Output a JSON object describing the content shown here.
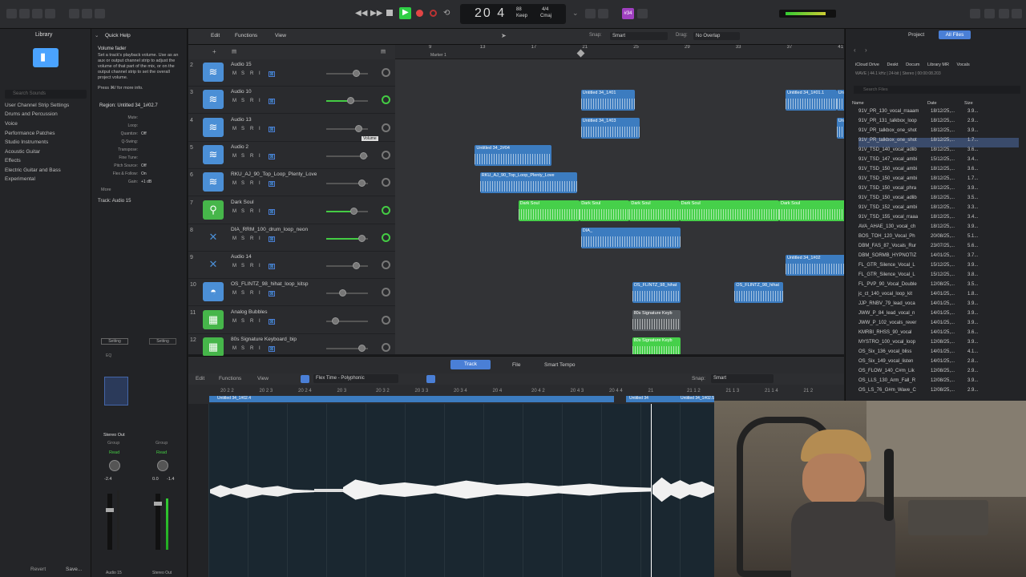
{
  "toolbar": {
    "lcd_position": "20 4",
    "lcd_tempo": "88",
    "lcd_tempo_label": "Keep",
    "lcd_sig": "4/4",
    "lcd_key": "Cmaj",
    "badge": "#34"
  },
  "library": {
    "title": "Library",
    "search_placeholder": "Search Sounds",
    "items": [
      "User Channel Strip Settings",
      "Drums and Percussion",
      "Voice",
      "Performance Patches",
      "Studio Instruments",
      "Acoustic Guitar",
      "Effects",
      "Electric Guitar and Bass",
      "Experimental"
    ],
    "revert": "Revert",
    "save": "Save..."
  },
  "inspector": {
    "title": "Quick Help",
    "help_title": "Volume fader",
    "help_text": "Set a track's playback volume. Use as an aux or output channel strip to adjust the volume of that part of the mix, or on the output channel strip to set the overall project volume.",
    "help_more": "Press ⌘/ for more info.",
    "region_label": "Region: Untitled 34_1#02.7",
    "fields": [
      {
        "k": "Mute:",
        "v": ""
      },
      {
        "k": "Loop:",
        "v": ""
      },
      {
        "k": "Quantize:",
        "v": "Off"
      },
      {
        "k": "Q-Swing:",
        "v": ""
      },
      {
        "k": "Transpose:",
        "v": ""
      },
      {
        "k": "Fine Tune:",
        "v": ""
      },
      {
        "k": "Pitch Source:",
        "v": "Off"
      },
      {
        "k": "Flex & Follow:",
        "v": "On"
      },
      {
        "k": "Gain:",
        "v": "+1 dB"
      }
    ],
    "more": "More",
    "track_label": "Track: Audio 15",
    "strip_left_name": "Audio 15",
    "strip_right_name": "Stereo Out",
    "strip_left_db": "-2.4",
    "strip_right_db": "0.0",
    "strip_right_db2": "-1.4",
    "read_left": "Read",
    "read_right": "Read",
    "stereo_out": "Stereo Out",
    "group": "Group",
    "setting": "Setting",
    "eq": "EQ"
  },
  "tracks_top": {
    "edit": "Edit",
    "functions": "Functions",
    "view": "View",
    "snap_label": "Snap:",
    "snap_value": "Smart",
    "drag_label": "Drag:",
    "drag_value": "No Overlap",
    "marker": "Marker 1",
    "bars": [
      "9",
      "13",
      "17",
      "21",
      "25",
      "29",
      "33",
      "37",
      "41"
    ]
  },
  "tracks": [
    {
      "num": "2",
      "name": "Audio 15",
      "color": "#4b8fd6",
      "kind": "audio",
      "vol": 0.72
    },
    {
      "num": "3",
      "name": "Audio 10",
      "color": "#4b8fd6",
      "kind": "audio",
      "vol": 0.58,
      "active": true
    },
    {
      "num": "4",
      "name": "Audio 13",
      "color": "#4b8fd6",
      "kind": "audio",
      "vol": 0.76,
      "tooltip": "Volume"
    },
    {
      "num": "5",
      "name": "Audio 2",
      "color": "#4b8fd6",
      "kind": "audio",
      "vol": 0.88
    },
    {
      "num": "6",
      "name": "RKU_AJ_90_Top_Loop_Plenty_Love",
      "color": "#4b8fd6",
      "kind": "audio",
      "vol": 0.84
    },
    {
      "num": "7",
      "name": "Dark Soul",
      "color": "#46b64a",
      "kind": "guitar",
      "vol": 0.66,
      "active": true
    },
    {
      "num": "8",
      "name": "DIA_RRM_100_drum_loop_neon",
      "color": "#4b8fd6",
      "kind": "drum",
      "vol": 0.84,
      "active": true
    },
    {
      "num": "9",
      "name": "Audio 14",
      "color": "#4b8fd6",
      "kind": "drum",
      "vol": 0.72
    },
    {
      "num": "10",
      "name": "OS_FLINTZ_98_hihat_loop_kitsp",
      "color": "#4b8fd6",
      "kind": "cymbal",
      "vol": 0.38
    },
    {
      "num": "11",
      "name": "Analog Bubbles",
      "color": "#46b64a",
      "kind": "synth",
      "vol": 0.22
    },
    {
      "num": "12",
      "name": "80s Signature Keyboard_bip",
      "color": "#46b64a",
      "kind": "synth",
      "vol": 0.84
    }
  ],
  "regions": [
    {
      "label": "Untitled 34_1#01",
      "row": 1,
      "start": 11.9,
      "len": 4.2,
      "color": "blue"
    },
    {
      "label": "Untitled 34_1#01.1",
      "row": 1,
      "start": 27.9,
      "len": 4,
      "color": "blue"
    },
    {
      "label": "Untitled 34_1#01.1",
      "row": 1,
      "start": 31.9,
      "len": 4.6,
      "color": "blue"
    },
    {
      "label": "Untitled 34_1#03",
      "row": 2,
      "start": 11.9,
      "len": 4.6,
      "color": "blue"
    },
    {
      "label": "Untitled 34_1#03.1",
      "row": 2,
      "start": 31.9,
      "len": 4.6,
      "color": "blue"
    },
    {
      "label": "Untitled 34_2#04",
      "row": 3,
      "start": 3.6,
      "len": 6,
      "color": "blue"
    },
    {
      "label": "RKU_AJ_90_Top_Loop_Plenty_Love",
      "row": 4,
      "start": 4,
      "len": 7.6,
      "color": "blue"
    },
    {
      "label": "Dark Soul",
      "row": 5,
      "start": 7,
      "len": 4.8,
      "color": "green"
    },
    {
      "label": "Dark Soul",
      "row": 5,
      "start": 11.8,
      "len": 3.9,
      "color": "green"
    },
    {
      "label": "Dark Soul",
      "row": 5,
      "start": 15.7,
      "len": 3.9,
      "color": "green"
    },
    {
      "label": "Dark Soul",
      "row": 5,
      "start": 19.6,
      "len": 7.8,
      "color": "green"
    },
    {
      "label": "Dark Soul",
      "row": 5,
      "start": 27.4,
      "len": 7.8,
      "color": "green"
    },
    {
      "label": "DIA_",
      "row": 6,
      "start": 11.9,
      "len": 7.8,
      "color": "blue"
    },
    {
      "label": "Untitled 34_1#02",
      "row": 7,
      "start": 27.9,
      "len": 7.8,
      "color": "blue"
    },
    {
      "label": "OS_FLINTZ_98_hihat",
      "row": 8,
      "start": 15.9,
      "len": 3.8,
      "color": "blue"
    },
    {
      "label": "OS_FLINTZ_98_hihat",
      "row": 8,
      "start": 23.9,
      "len": 3.8,
      "color": "blue"
    },
    {
      "label": "80s Signature Keyb",
      "row": 9,
      "start": 15.9,
      "len": 3.8,
      "color": "gray"
    },
    {
      "label": "80s Signature Keyb",
      "row": 10,
      "start": 15.9,
      "len": 3.8,
      "color": "green"
    }
  ],
  "browser": {
    "tab_project": "Project",
    "tab_all": "All Files",
    "locations": [
      "iCloud Drive",
      "Deskt",
      "Docum",
      "Library MR",
      "Vocals"
    ],
    "info": "WAVE | 44.1 kHz | 24-bit | Stereo | 00:00:08.203",
    "search_placeholder": "Search Files",
    "col_name": "Name",
    "col_date": "Date",
    "col_size": "Size",
    "files": [
      {
        "n": "91V_PR_130_vocal_rraaam",
        "d": "18/12/25,...",
        "s": "3.9..."
      },
      {
        "n": "91V_PR_131_talkbox_loop",
        "d": "18/12/25,...",
        "s": "2.9..."
      },
      {
        "n": "91V_PR_talkbox_one_shot",
        "d": "18/12/25,...",
        "s": "3.9..."
      },
      {
        "n": "91V_PR_talkbox_one_shot",
        "d": "18/12/25,...",
        "s": "1.7..."
      },
      {
        "n": "91V_TSD_140_vocal_adlib",
        "d": "18/12/25,...",
        "s": "3.6..."
      },
      {
        "n": "91V_TSD_147_vocal_ambi",
        "d": "15/12/25,...",
        "s": "3.4..."
      },
      {
        "n": "91V_TSD_150_vocal_ambi",
        "d": "18/12/25,...",
        "s": "3.6..."
      },
      {
        "n": "91V_TSD_150_vocal_ambi",
        "d": "18/12/25,...",
        "s": "1.7..."
      },
      {
        "n": "91V_TSD_150_vocal_phra",
        "d": "18/12/25,...",
        "s": "3.9..."
      },
      {
        "n": "91V_TSD_150_vocal_adlib",
        "d": "18/12/25,...",
        "s": "3.5..."
      },
      {
        "n": "91V_TSD_152_vocal_ambi",
        "d": "18/12/25,...",
        "s": "3.3..."
      },
      {
        "n": "91V_TSD_155_vocal_rraaa",
        "d": "18/12/25,...",
        "s": "3.4..."
      },
      {
        "n": "AVA_AHAE_130_vocal_ch",
        "d": "18/12/25,...",
        "s": "3.9..."
      },
      {
        "n": "BOS_TOH_120_Vocal_Ph",
        "d": "20/08/25,...",
        "s": "5.1..."
      },
      {
        "n": "DBM_FAS_87_Vocals_Rur",
        "d": "23/07/25,...",
        "s": "5.6..."
      },
      {
        "n": "DBM_SORMB_HYPNOTIZ",
        "d": "14/01/25,...",
        "s": "3.7..."
      },
      {
        "n": "FL_GTR_Silence_Vocal_L",
        "d": "15/12/25,...",
        "s": "3.9..."
      },
      {
        "n": "FL_GTR_Silence_Vocal_L",
        "d": "15/12/25,...",
        "s": "3.8..."
      },
      {
        "n": "FL_PVP_90_Vocal_Double",
        "d": "12/08/25,...",
        "s": "3.5..."
      },
      {
        "n": "jc_ct_140_vocal_loop_kit",
        "d": "14/01/25,...",
        "s": "1.8..."
      },
      {
        "n": "JJP_RNBV_79_lead_voca",
        "d": "14/01/25,...",
        "s": "3.9..."
      },
      {
        "n": "JWW_P_84_lead_vocal_n",
        "d": "14/01/25,...",
        "s": "3.9..."
      },
      {
        "n": "JWW_P_102_vocals_rever",
        "d": "14/01/25,...",
        "s": "3.9..."
      },
      {
        "n": "KMRBI_RHSS_90_vocal",
        "d": "14/01/25,...",
        "s": "3.6..."
      },
      {
        "n": "MYSTRO_100_vocal_loop",
        "d": "12/08/25,...",
        "s": "3.9..."
      },
      {
        "n": "OS_Six_136_vocal_bliss",
        "d": "14/01/25,...",
        "s": "4.1..."
      },
      {
        "n": "OS_Six_149_vocal_listen",
        "d": "14/01/25,...",
        "s": "2.8..."
      },
      {
        "n": "OS_FLOW_140_C#m_Lik",
        "d": "12/08/25,...",
        "s": "2.9..."
      },
      {
        "n": "OS_LLS_130_Arm_Fall_R",
        "d": "12/08/25,...",
        "s": "3.9..."
      },
      {
        "n": "OS_LS_76_G#m_Wave_C",
        "d": "12/08/25,...",
        "s": "2.9..."
      }
    ]
  },
  "editor": {
    "tab_track": "Track",
    "tab_file": "File",
    "tab_smart": "Smart Tempo",
    "edit": "Edit",
    "functions": "Functions",
    "view": "View",
    "flex": "Flex Time - Polyphonic",
    "snap_label": "Snap:",
    "snap_value": "Smart",
    "ruler": [
      "20 2 2",
      "20 2 3",
      "20 2 4",
      "20 3",
      "20 3 2",
      "20 3 3",
      "20 3 4",
      "20 4",
      "20 4 2",
      "20 4 3",
      "20 4 4",
      "21",
      "21 1 2",
      "21 1 3",
      "21 1 4",
      "21 2"
    ],
    "region_a": "Untitled 34_1#02.4",
    "region_b": "Untitled 34",
    "region_c": "Untitled 34_1#02.5"
  },
  "colors": {
    "accent": "#4aa3ff",
    "audio_region": "#3c7cc0",
    "midi_region": "#46d04a",
    "record": "#e24545",
    "play": "#2fcf45"
  }
}
